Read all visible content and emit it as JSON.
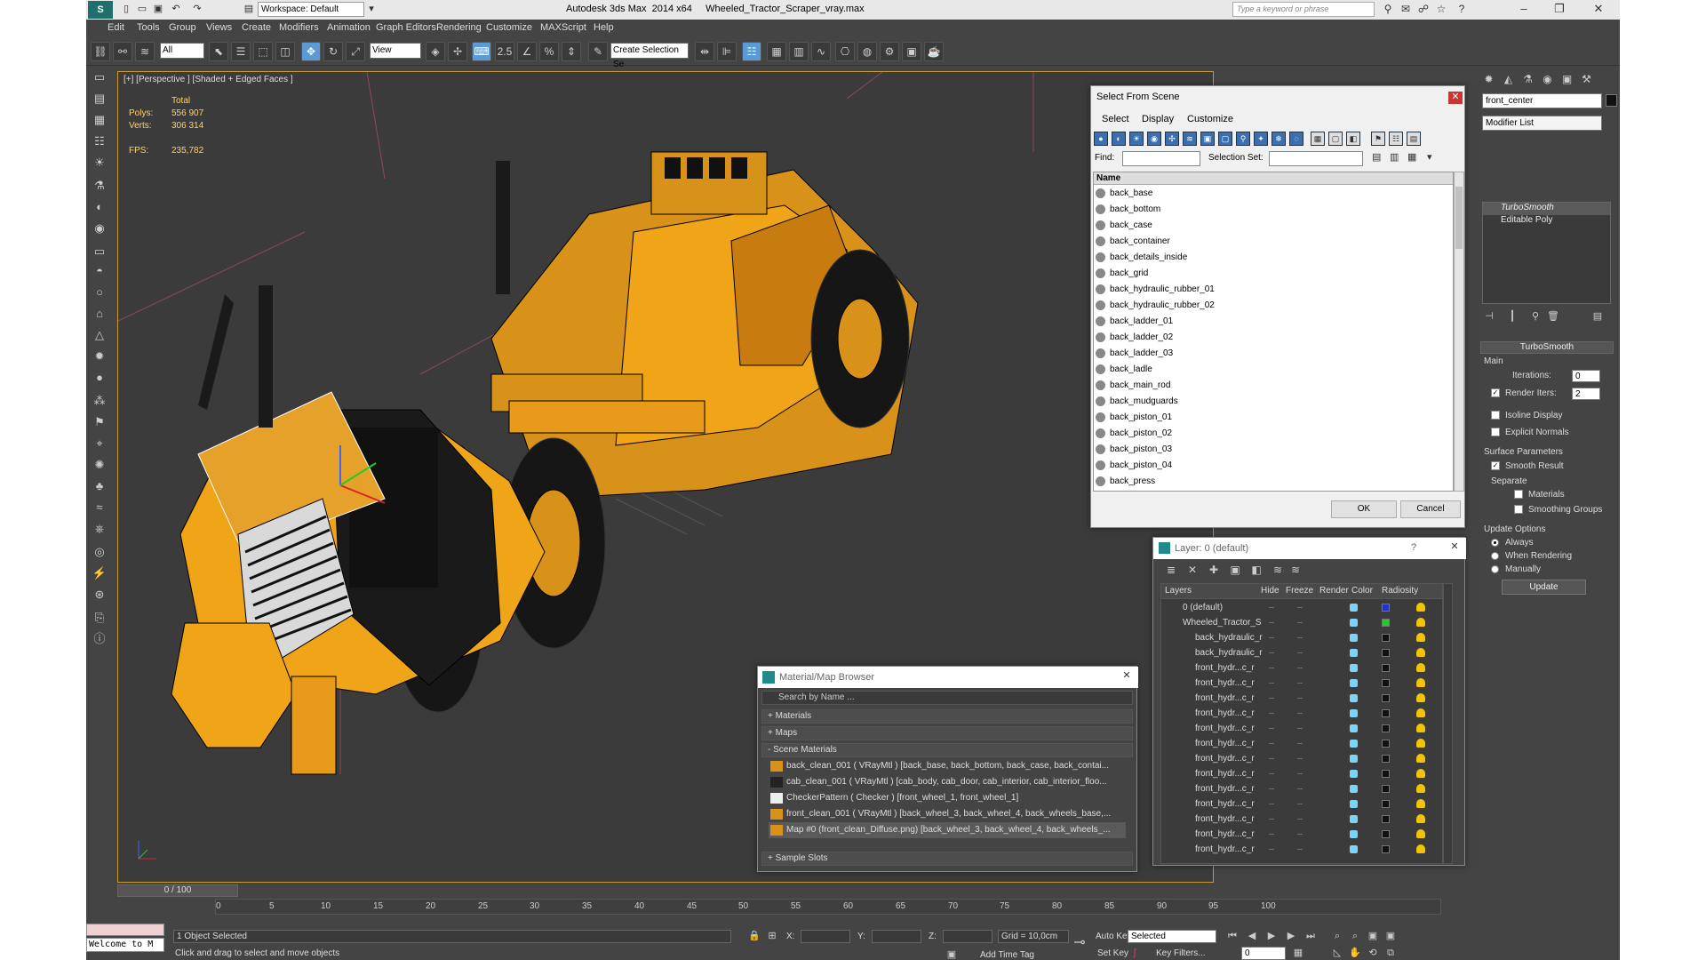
{
  "app": {
    "title": "Autodesk 3ds Max  2014 x64     Wheeled_Tractor_Scraper_vray.max",
    "workspace": "Workspace: Default",
    "search_placeholder": "Type a keyword or phrase"
  },
  "menu": [
    "Edit",
    "Tools",
    "Group",
    "Views",
    "Create",
    "Modifiers",
    "Animation",
    "Graph Editors",
    "Rendering",
    "Customize",
    "MAXScript",
    "Help"
  ],
  "toolbar": {
    "filter_value": "All",
    "ref_coord": "View",
    "selection_set": "Create Selection Se",
    "snap_label": "2.5"
  },
  "viewport": {
    "label": "[+] [Perspective ] [Shaded + Edged Faces ]",
    "stats": {
      "total_label": "Total",
      "polys_label": "Polys:",
      "polys_value": "556 907",
      "verts_label": "Verts:",
      "verts_value": "306 314",
      "fps_label": "FPS:",
      "fps_value": "235,782"
    }
  },
  "command_panel": {
    "object_name": "front_center",
    "modifier_list": "Modifier List",
    "stack": [
      "TurboSmooth",
      "Editable Poly"
    ],
    "rollout_title": "TurboSmooth",
    "main_label": "Main",
    "iterations_label": "Iterations:",
    "iterations_value": "0",
    "render_iters_label": "Render Iters:",
    "render_iters_value": "2",
    "isoline": "Isoline Display",
    "explicit_normals": "Explicit Normals",
    "surface_params": "Surface Parameters",
    "smooth_result": "Smooth Result",
    "separate": "Separate",
    "materials": "Materials",
    "smoothing_groups": "Smoothing Groups",
    "update_options": "Update Options",
    "always": "Always",
    "when_rendering": "When Rendering",
    "manually": "Manually",
    "update_button": "Update"
  },
  "select_from_scene": {
    "title": "Select From Scene",
    "menu": [
      "Select",
      "Display",
      "Customize"
    ],
    "find_label": "Find:",
    "selection_set_label": "Selection Set:",
    "column_name": "Name",
    "items": [
      "back_base",
      "back_bottom",
      "back_case",
      "back_container",
      "back_details_inside",
      "back_grid",
      "back_hydraulic_rubber_01",
      "back_hydraulic_rubber_02",
      "back_ladder_01",
      "back_ladder_02",
      "back_ladder_03",
      "back_ladle",
      "back_main_rod",
      "back_mudguards",
      "back_piston_01",
      "back_piston_02",
      "back_piston_03",
      "back_piston_04",
      "back_press"
    ],
    "ok": "OK",
    "cancel": "Cancel"
  },
  "layer_dialog": {
    "title": "Layer: 0 (default)",
    "help": "?",
    "columns": [
      "Layers",
      "Hide",
      "Freeze",
      "Render",
      "Color",
      "Radiosity"
    ],
    "rows": [
      {
        "name": "0 (default)",
        "indent": 1,
        "color": "#2233cc"
      },
      {
        "name": "Wheeled_Tractor_S",
        "indent": 1,
        "color": "#22cc22"
      },
      {
        "name": "back_hydraulic_r",
        "indent": 2,
        "color": "#111111"
      },
      {
        "name": "back_hydraulic_r",
        "indent": 2,
        "color": "#111111"
      },
      {
        "name": "front_hydr...c_r",
        "indent": 2,
        "color": "#111111"
      },
      {
        "name": "front_hydr...c_r",
        "indent": 2,
        "color": "#111111"
      },
      {
        "name": "front_hydr...c_r",
        "indent": 2,
        "color": "#111111"
      },
      {
        "name": "front_hydr...c_r",
        "indent": 2,
        "color": "#111111"
      },
      {
        "name": "front_hydr...c_r",
        "indent": 2,
        "color": "#111111"
      },
      {
        "name": "front_hydr...c_r",
        "indent": 2,
        "color": "#111111"
      },
      {
        "name": "front_hydr...c_r",
        "indent": 2,
        "color": "#111111"
      },
      {
        "name": "front_hydr...c_r",
        "indent": 2,
        "color": "#111111"
      },
      {
        "name": "front_hydr...c_r",
        "indent": 2,
        "color": "#111111"
      },
      {
        "name": "front_hydr...c_r",
        "indent": 2,
        "color": "#111111"
      },
      {
        "name": "front_hydr...c_r",
        "indent": 2,
        "color": "#111111"
      },
      {
        "name": "front_hydr...c_r",
        "indent": 2,
        "color": "#111111"
      },
      {
        "name": "front_hydr...c_r",
        "indent": 2,
        "color": "#111111"
      }
    ]
  },
  "material_browser": {
    "title": "Material/Map Browser",
    "search_placeholder": "Search by Name ...",
    "sections": [
      "+ Materials",
      "+ Maps",
      "- Scene Materials",
      "+ Sample Slots"
    ],
    "scene_materials": [
      "back_clean_001  ( VRayMtl )  [back_base, back_bottom, back_case, back_contai...",
      "cab_clean_001  ( VRayMtl )  [cab_body, cab_door, cab_interior, cab_interior_floo...",
      "CheckerPattern  ( Checker )  [front_wheel_1, front_wheel_1]",
      "front_clean_001  ( VRayMtl )  [back_wheel_3, back_wheel_4, back_wheels_base,...",
      "Map #0 (front_clean_Diffuse.png)  [back_wheel_3, back_wheel_4, back_wheels_..."
    ]
  },
  "timeline": {
    "slider": "0 / 100",
    "ticks": [
      "0",
      "5",
      "10",
      "15",
      "20",
      "25",
      "30",
      "35",
      "40",
      "45",
      "50",
      "55",
      "60",
      "65",
      "70",
      "75",
      "80",
      "85",
      "90",
      "95",
      "100"
    ]
  },
  "status": {
    "maxscript": "Welcome to M",
    "selected": "1 Object Selected",
    "prompt": "Click and drag to select and move objects",
    "x_label": "X:",
    "y_label": "Y:",
    "z_label": "Z:",
    "grid": "Grid = 10,0cm",
    "add_time_tag": "Add Time Tag",
    "auto_key": "Auto Key",
    "set_key": "Set Key",
    "selected_dropdown": "Selected",
    "key_filters": "Key Filters...",
    "frame": "0"
  }
}
